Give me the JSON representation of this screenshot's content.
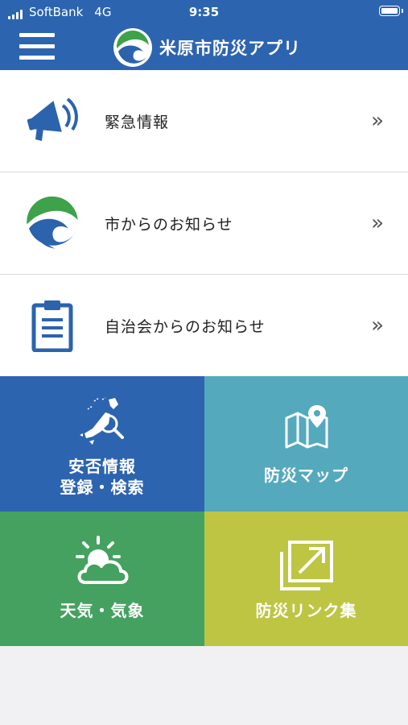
{
  "status_bar": {
    "carrier": "SoftBank",
    "network": "4G",
    "time": "9:35"
  },
  "header": {
    "title": "米原市防災アプリ"
  },
  "menu": [
    {
      "label": "緊急情報",
      "icon": "megaphone-icon"
    },
    {
      "label": "市からのお知らせ",
      "icon": "city-logo-icon"
    },
    {
      "label": "自治会からのお知らせ",
      "icon": "clipboard-icon"
    }
  ],
  "chevron": "»",
  "tiles": [
    {
      "label_line1": "安否情報",
      "label_line2": "登録・検索",
      "icon": "japan-map-search-icon",
      "color": "#2d64af"
    },
    {
      "label": "防災マップ",
      "icon": "map-pin-icon",
      "color": "#55a9bd"
    },
    {
      "label": "天気・気象",
      "icon": "weather-sun-cloud-icon",
      "color": "#45a160"
    },
    {
      "label": "防災リンク集",
      "icon": "external-link-icon",
      "color": "#bdc543"
    }
  ],
  "colors": {
    "header": "#2c64b0",
    "icon_blue": "#2b63ad",
    "logo_green": "#3da24a"
  }
}
